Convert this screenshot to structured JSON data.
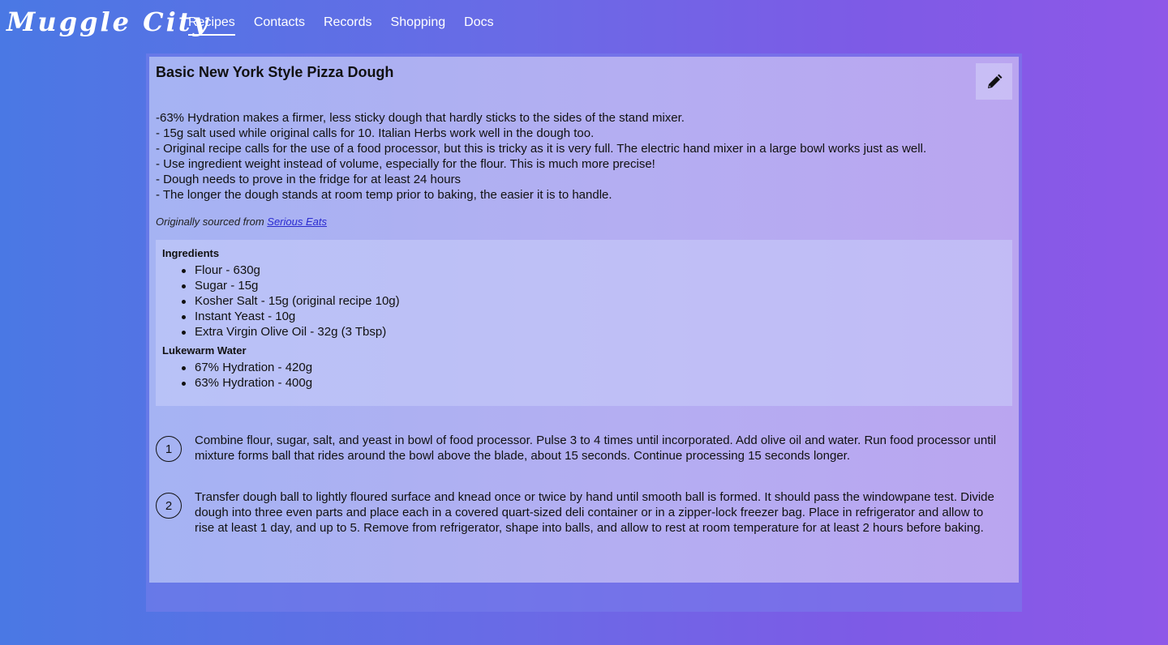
{
  "app": {
    "logo": "Muggle City"
  },
  "nav": {
    "items": [
      {
        "label": "Recipes",
        "active": true
      },
      {
        "label": "Contacts"
      },
      {
        "label": "Records"
      },
      {
        "label": "Shopping"
      },
      {
        "label": "Docs"
      }
    ]
  },
  "recipe": {
    "title": "Basic New York Style Pizza Dough",
    "edit_icon": "pencil-icon",
    "notes": [
      "-63% Hydration makes a firmer, less sticky dough that hardly sticks to the sides of the stand mixer.",
      "- 15g salt used while original calls for 10. Italian Herbs work well in the dough too.",
      "- Original recipe calls for the use of a food processor, but this is tricky as it is very full. The electric hand mixer in a large bowl works just as well.",
      "- Use ingredient weight instead of volume, especially for the flour. This is much more precise!",
      "- Dough needs to prove in the fridge for at least 24 hours",
      "- The longer the dough stands at room temp prior to baking, the easier it is to handle."
    ],
    "source_prefix": "Originally sourced from",
    "source_link": "Serious Eats",
    "ingredient_groups": [
      {
        "heading": "Ingredients",
        "items": [
          "Flour - 630g",
          "Sugar - 15g",
          "Kosher Salt - 15g (original recipe 10g)",
          "Instant Yeast - 10g",
          "Extra Virgin Olive Oil - 32g (3 Tbsp)"
        ]
      },
      {
        "heading": "Lukewarm Water",
        "items": [
          "67% Hydration - 420g",
          "63% Hydration - 400g"
        ]
      }
    ],
    "steps": [
      {
        "number": "1",
        "text": "Combine flour, sugar, salt, and yeast in bowl of food processor. Pulse 3 to 4 times until incorporated. Add olive oil and water. Run food processor until mixture forms ball that rides around the bowl above the blade, about 15 seconds. Continue processing 15 seconds longer."
      },
      {
        "number": "2",
        "text": "Transfer dough ball to lightly floured surface and knead once or twice by hand until smooth ball is formed. It should pass the windowpane test. Divide dough into three even parts and place each in a covered quart-sized deli container or in a zipper-lock freezer bag. Place in refrigerator and allow to rise at least 1 day, and up to 5. Remove from refrigerator, shape into balls, and allow to rest at room temperature for at least 2 hours before baking."
      }
    ]
  }
}
